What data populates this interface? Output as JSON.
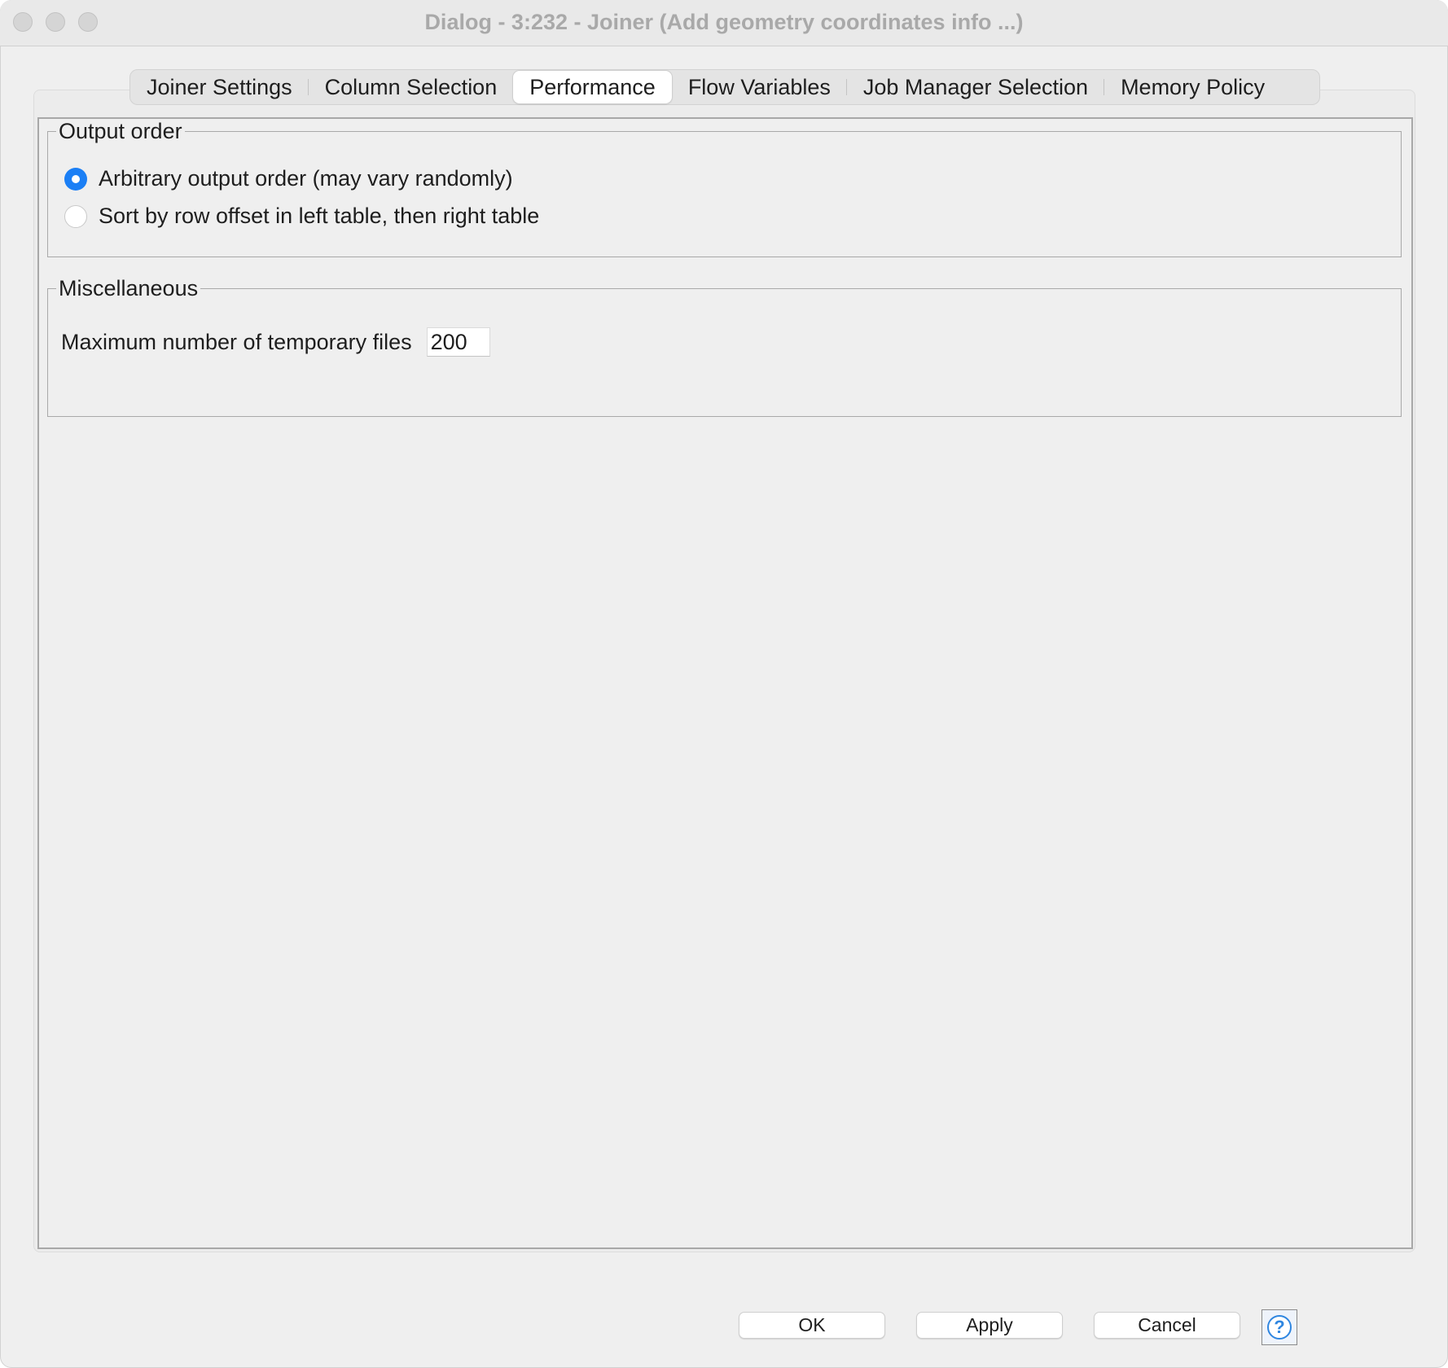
{
  "window": {
    "title": "Dialog - 3:232 - Joiner (Add geometry coordinates info ...)"
  },
  "tabs": [
    {
      "label": "Joiner Settings",
      "active": false
    },
    {
      "label": "Column Selection",
      "active": false
    },
    {
      "label": "Performance",
      "active": true
    },
    {
      "label": "Flow Variables",
      "active": false
    },
    {
      "label": "Job Manager Selection",
      "active": false
    },
    {
      "label": "Memory Policy",
      "active": false
    }
  ],
  "output_order": {
    "legend": "Output order",
    "options": [
      {
        "label": "Arbitrary output order (may vary randomly)",
        "selected": true
      },
      {
        "label": "Sort by row offset in left table, then right table",
        "selected": false
      }
    ]
  },
  "misc": {
    "legend": "Miscellaneous",
    "max_temp_files_label": "Maximum number of temporary files",
    "max_temp_files_value": "200"
  },
  "buttons": {
    "ok": "OK",
    "apply": "Apply",
    "cancel": "Cancel",
    "help_glyph": "?"
  },
  "colors": {
    "accent": "#1b7ff5",
    "help": "#2f86e0"
  }
}
